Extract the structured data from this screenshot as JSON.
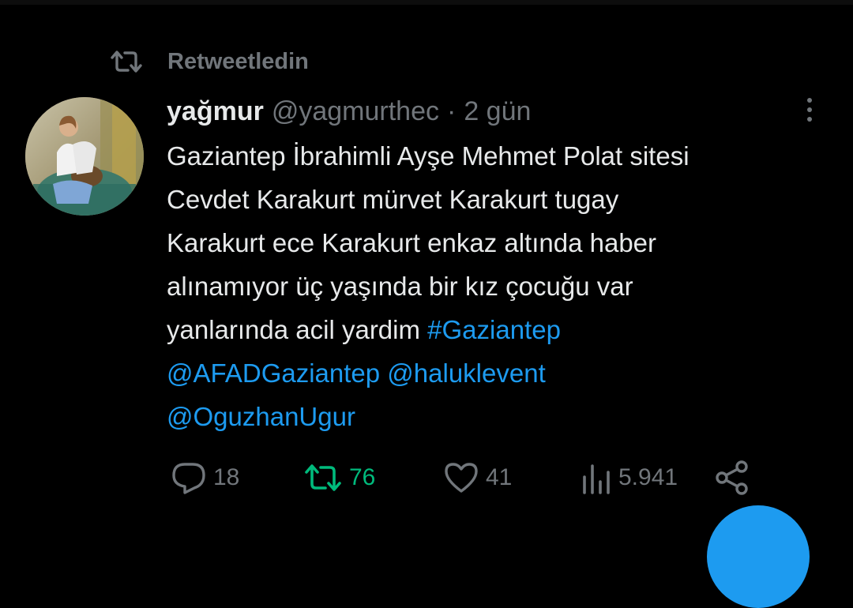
{
  "retweet_context": {
    "icon": "retweet-icon",
    "label": "Retweetledin"
  },
  "tweet": {
    "author": {
      "display_name": "yağmur",
      "handle": "@yagmurthec",
      "avatar": "avatar-photo"
    },
    "separator": "·",
    "time": "2 gün",
    "more_icon": "more-dots-icon",
    "text_lines": [
      "Gaziantep İbrahimli Ayşe Mehmet Polat sitesi",
      "Cevdet Karakurt mürvet Karakurt tugay",
      "Karakurt ece Karakurt enkaz altında haber",
      "alınamıyor üç yaşında bir kız çocuğu var",
      "yanlarında acil yardim"
    ],
    "hashtag": "#Gaziantep",
    "mentions": [
      "@AFADGaziantep",
      "@haluklevent",
      "@OguzhanUgur"
    ]
  },
  "actions": {
    "reply": {
      "icon": "reply-icon",
      "count": "18"
    },
    "retweet": {
      "icon": "retweet-icon",
      "count": "76",
      "active_color": "#00ba7c"
    },
    "like": {
      "icon": "heart-icon",
      "count": "41"
    },
    "views": {
      "icon": "views-icon",
      "count": "5.941"
    },
    "share": {
      "icon": "share-icon"
    }
  },
  "colors": {
    "background": "#000000",
    "text": "#e7e9ea",
    "secondary_text": "#71767b",
    "link": "#1d9bf0",
    "retweet_green": "#00ba7c"
  }
}
